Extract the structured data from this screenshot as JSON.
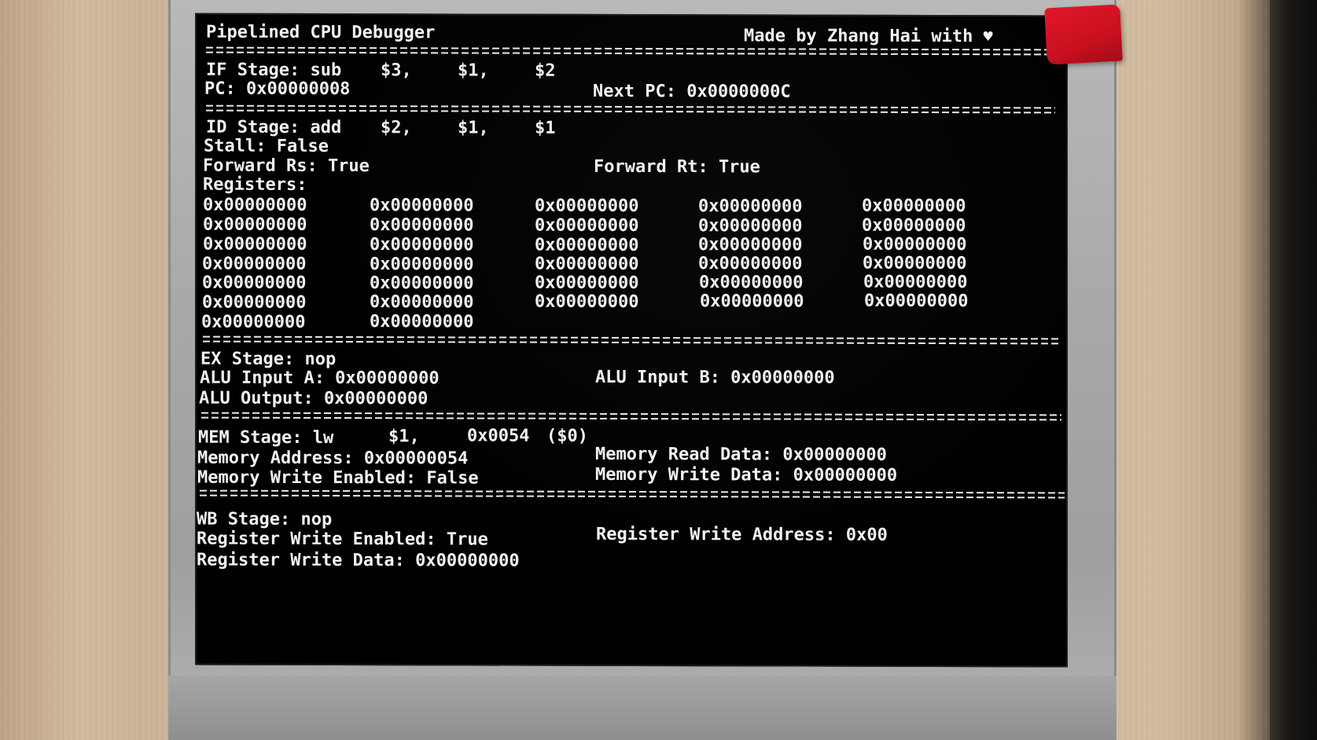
{
  "header": {
    "title": "Pipelined CPU Debugger",
    "credit": "Made by Zhang Hai with",
    "heart_icon": "heart-icon"
  },
  "if_stage": {
    "stage": "IF Stage: sub",
    "operands": [
      "$3,",
      "$1,",
      "$2"
    ],
    "pc": "PC: 0x00000008",
    "next_pc": "Next PC: 0x0000000C"
  },
  "id_stage": {
    "stage": "ID Stage: add",
    "operands": [
      "$2,",
      "$1,",
      "$1"
    ],
    "stall": "Stall: False",
    "forward_rs": "Forward Rs: True",
    "forward_rt": "Forward Rt: True",
    "registers_label": "Registers:",
    "registers": [
      [
        "0x00000000",
        "0x00000000",
        "0x00000000",
        "0x00000000",
        "0x00000000"
      ],
      [
        "0x00000000",
        "0x00000000",
        "0x00000000",
        "0x00000000",
        "0x00000000"
      ],
      [
        "0x00000000",
        "0x00000000",
        "0x00000000",
        "0x00000000",
        "0x00000000"
      ],
      [
        "0x00000000",
        "0x00000000",
        "0x00000000",
        "0x00000000",
        "0x00000000"
      ],
      [
        "0x00000000",
        "0x00000000",
        "0x00000000",
        "0x00000000",
        "0x00000000"
      ],
      [
        "0x00000000",
        "0x00000000",
        "0x00000000",
        "0x00000000",
        "0x00000000"
      ],
      [
        "0x00000000",
        "0x00000000"
      ]
    ]
  },
  "ex_stage": {
    "stage": "EX Stage: nop",
    "alu_a": "ALU Input A: 0x00000000",
    "alu_b": "ALU Input B: 0x00000000",
    "alu_out": "ALU Output: 0x00000000"
  },
  "mem_stage": {
    "stage": "MEM Stage: lw",
    "operands": [
      "$1,",
      "0x0054",
      "($0)"
    ],
    "address": "Memory Address: 0x00000054",
    "read_data": "Memory Read Data: 0x00000000",
    "write_enabled": "Memory Write Enabled: False",
    "write_data": "Memory Write Data: 0x00000000"
  },
  "wb_stage": {
    "stage": "WB Stage: nop",
    "write_enabled": "Register Write Enabled: True",
    "write_address": "Register Write Address: 0x00",
    "write_data": "Register Write Data: 0x00000000"
  }
}
